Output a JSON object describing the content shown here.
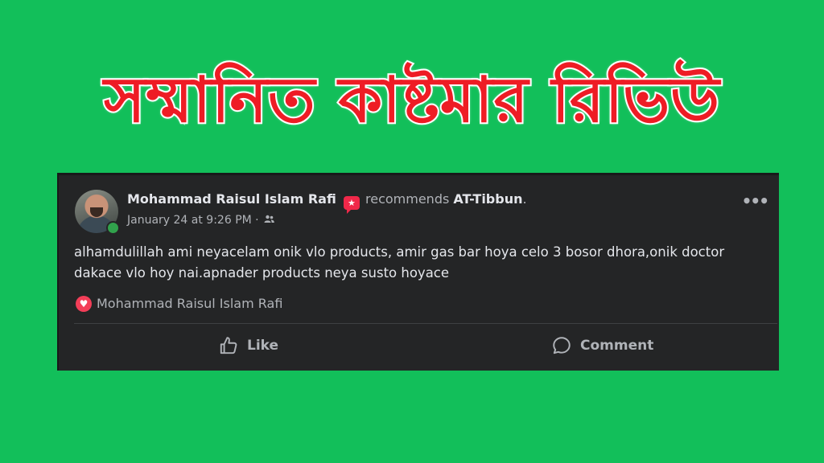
{
  "banner": {
    "title": "সম্মানিত কাষ্টমার রিভিউ"
  },
  "post": {
    "author": "Mohammad Raisul Islam Rafi",
    "recommend_verb": "recommends",
    "page_name": "AT-Tibbun",
    "page_suffix": ".",
    "timestamp": "January 24 at 9:26 PM",
    "meta_separator": "·",
    "privacy_icon": "friends-icon",
    "more_label": "•••",
    "body": "alhamdulillah ami neyacelam onik vlo products, amir gas bar hoya celo 3 bosor dhora,onik doctor dakace vlo hoy nai.apnader products neya susto hoyace",
    "reaction_name": "Mohammad Raisul Islam Rafi",
    "like_label": "Like",
    "comment_label": "Comment"
  },
  "colors": {
    "background": "#12bf5a",
    "banner_text": "#ee1c25",
    "card": "#242526",
    "love": "#f33e58",
    "online": "#31a24c"
  }
}
